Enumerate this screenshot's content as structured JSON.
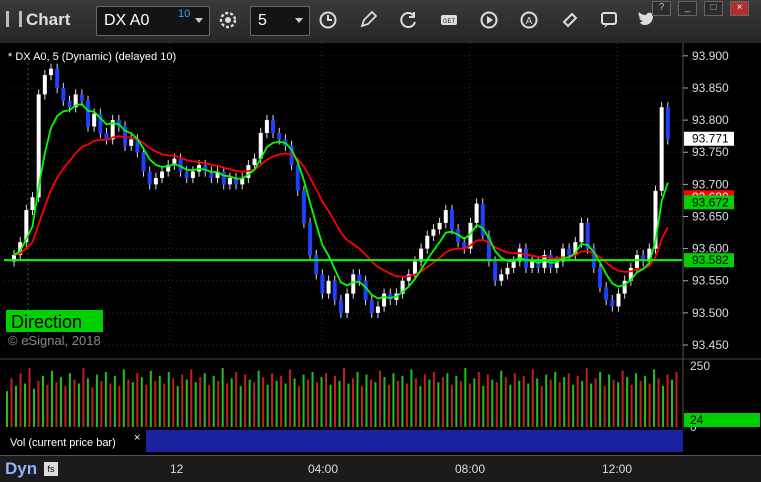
{
  "toolbar": {
    "app_title": "Chart",
    "symbol": "DX A0",
    "symbol_badge": "10",
    "interval": "5",
    "icons": [
      "settings-gear-icon",
      "clock-icon",
      "pencil-icon",
      "refresh-icon",
      "get-icon",
      "play-icon",
      "alert-icon",
      "link-icon",
      "chat-icon",
      "twitter-icon"
    ],
    "window_controls": [
      "?",
      "_",
      "□",
      "×"
    ]
  },
  "chart_data": {
    "type": "candlestick",
    "title": "* DX A0, 5 (Dynamic) (delayed 10)",
    "watermark": "© eSignal, 2018",
    "ylim": [
      93.45,
      93.92
    ],
    "yticks": [
      "93.900",
      "93.850",
      "93.800",
      "93.750",
      "93.700",
      "93.650",
      "93.600",
      "93.550",
      "93.500",
      "93.450"
    ],
    "x_labels": [
      "12",
      "04:00",
      "08:00",
      "12:00"
    ],
    "closes": [
      93.59,
      93.61,
      93.66,
      93.68,
      93.84,
      93.87,
      93.88,
      93.85,
      93.83,
      93.82,
      93.84,
      93.83,
      93.79,
      93.81,
      93.78,
      93.77,
      93.8,
      93.79,
      93.76,
      93.77,
      93.75,
      93.72,
      93.7,
      93.71,
      93.72,
      93.73,
      93.74,
      93.72,
      93.71,
      93.72,
      93.73,
      93.72,
      93.71,
      93.72,
      93.7,
      93.71,
      93.7,
      93.71,
      93.73,
      93.74,
      93.78,
      93.8,
      93.78,
      93.77,
      93.76,
      93.73,
      93.69,
      93.64,
      93.59,
      93.56,
      93.53,
      93.55,
      93.52,
      93.5,
      93.53,
      93.56,
      93.55,
      93.52,
      93.5,
      93.51,
      93.53,
      93.52,
      93.53,
      93.55,
      93.56,
      93.58,
      93.6,
      93.62,
      93.63,
      93.64,
      93.66,
      93.63,
      93.61,
      93.6,
      93.64,
      93.67,
      93.62,
      93.58,
      93.55,
      93.56,
      93.57,
      93.58,
      93.6,
      93.57,
      93.58,
      93.57,
      93.59,
      93.57,
      93.58,
      93.6,
      93.59,
      93.61,
      93.64,
      93.6,
      93.57,
      93.54,
      93.52,
      93.51,
      93.53,
      93.55,
      93.57,
      93.59,
      93.58,
      93.6,
      93.69,
      93.82,
      93.77
    ],
    "indicators": [
      {
        "name": "Direction",
        "color": "#00ff00",
        "level": 93.582,
        "label": "93.582",
        "kind": "horizontal"
      },
      {
        "name": "Direction (red)",
        "color": "#ff0000",
        "level": 93.68,
        "label": "93.680",
        "kind": "step"
      },
      {
        "name": "Direction (green)",
        "color": "#00ff00",
        "label": "93.672",
        "kind": "ema"
      }
    ],
    "current_price": "93.771",
    "volume": {
      "label": "Vol (current price bar)",
      "yticks": [
        "250",
        "0"
      ],
      "current": "24",
      "values": [
        140,
        190,
        160,
        210,
        170,
        230,
        150,
        180,
        200,
        165,
        220,
        175,
        195,
        160,
        210,
        185,
        170,
        230,
        190,
        155,
        205,
        180,
        215,
        170,
        200,
        160,
        225,
        185,
        175,
        210,
        195,
        165,
        220,
        180,
        200,
        170,
        215,
        190,
        160,
        205,
        185,
        225,
        175,
        195,
        210,
        165,
        200,
        180,
        230,
        170,
        190,
        215,
        160,
        205,
        185,
        175,
        220,
        195,
        165,
        210,
        180,
        200,
        170,
        225,
        190,
        160,
        205,
        185,
        215,
        175,
        195,
        210,
        165,
        200,
        180,
        230,
        170,
        190,
        215,
        160,
        205,
        185,
        175,
        220,
        195,
        165,
        210,
        180,
        200,
        170,
        225,
        190,
        160,
        205,
        185,
        215,
        175,
        195,
        210,
        165,
        200,
        180,
        230,
        170,
        190,
        215,
        160,
        205,
        185,
        175,
        220,
        195,
        165,
        210,
        180,
        200,
        170,
        225,
        190,
        160,
        205,
        185,
        215,
        175,
        195,
        210,
        165,
        200,
        180,
        230,
        170,
        190,
        215,
        160,
        205,
        185,
        175,
        220,
        195,
        165,
        210,
        180,
        200,
        170,
        225,
        190,
        160,
        205,
        185,
        215
      ]
    },
    "direction_label": "Direction"
  },
  "bottom": {
    "dyn_label": "Dyn",
    "dyn_icon": "fs"
  }
}
